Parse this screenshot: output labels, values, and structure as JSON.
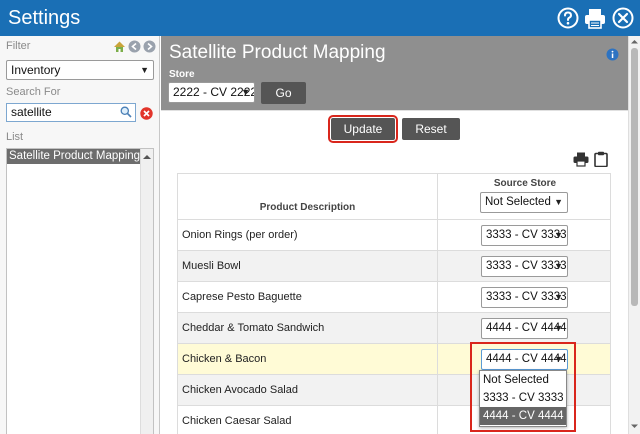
{
  "window": {
    "title": "Settings"
  },
  "left_panel": {
    "filter_label": "Filter",
    "filter_select": {
      "value": "Inventory"
    },
    "search_label": "Search For",
    "search_value": "satellite",
    "list_label": "List",
    "list_items": [
      {
        "label": "Satellite Product Mapping",
        "selected": true
      }
    ]
  },
  "main": {
    "title": "Satellite Product Mapping",
    "store_label": "Store",
    "store_select": {
      "value": "2222 - CV 2222"
    },
    "go_label": "Go",
    "update_label": "Update",
    "reset_label": "Reset",
    "table": {
      "columns": {
        "description": "Product Description",
        "source": "Source Store"
      },
      "header_select": {
        "value": "Not Selected"
      },
      "rows": [
        {
          "description": "Onion Rings (per order)",
          "source": "3333 - CV 3333"
        },
        {
          "description": "Muesli Bowl",
          "source": "3333 - CV 3333"
        },
        {
          "description": "Caprese Pesto Baguette",
          "source": "3333 - CV 3333"
        },
        {
          "description": "Cheddar & Tomato Sandwich",
          "source": "4444 - CV 4444"
        },
        {
          "description": "Chicken & Bacon",
          "source": "4444 - CV 4444"
        },
        {
          "description": "Chicken Avocado Salad",
          "source": ""
        },
        {
          "description": "Chicken Caesar Salad",
          "source": ""
        }
      ]
    },
    "dropdown_options": [
      {
        "label": "Not Selected",
        "selected": false
      },
      {
        "label": "3333 - CV 3333",
        "selected": false
      },
      {
        "label": "4444 - CV 4444",
        "selected": true
      }
    ]
  },
  "colors": {
    "titlebar": "#1a6fb5",
    "header": "#8f8f8f",
    "button": "#555555",
    "highlight": "#d9261c",
    "row_highlight": "#fffbd6"
  },
  "icons": [
    "help-icon",
    "print-icon",
    "close-icon",
    "home-icon",
    "back-icon",
    "forward-icon",
    "search-icon",
    "clear-icon",
    "info-icon",
    "printer-icon",
    "clipboard-icon"
  ]
}
